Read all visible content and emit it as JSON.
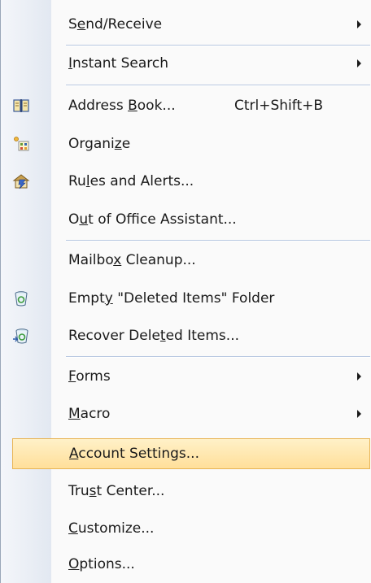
{
  "menu": {
    "items": [
      {
        "id": "send-receive",
        "pre": "S",
        "u": "e",
        "post": "nd/Receive",
        "submenu": true
      },
      {
        "id": "instant-search",
        "pre": "",
        "u": "I",
        "post": "nstant Search",
        "submenu": true
      },
      {
        "id": "address-book",
        "pre": "Address ",
        "u": "B",
        "post": "ook...",
        "shortcut": "Ctrl+Shift+B",
        "icon": "address-book-icon"
      },
      {
        "id": "organize",
        "pre": "Organi",
        "u": "z",
        "post": "e",
        "icon": "organize-icon"
      },
      {
        "id": "rules-and-alerts",
        "pre": "Ru",
        "u": "l",
        "post": "es and Alerts...",
        "icon": "rules-alerts-icon"
      },
      {
        "id": "out-of-office",
        "pre": "O",
        "u": "u",
        "post": "t of Office Assistant..."
      },
      {
        "id": "mailbox-cleanup",
        "pre": "Mailbo",
        "u": "x",
        "post": " Cleanup..."
      },
      {
        "id": "empty-deleted",
        "pre": "Empt",
        "u": "y",
        "post": " \"Deleted Items\" Folder",
        "icon": "recycle-bin-icon"
      },
      {
        "id": "recover-deleted",
        "pre": "Recover Dele",
        "u": "t",
        "post": "ed Items...",
        "icon": "recover-bin-icon"
      },
      {
        "id": "forms",
        "pre": "",
        "u": "F",
        "post": "orms",
        "submenu": true
      },
      {
        "id": "macro",
        "pre": "",
        "u": "M",
        "post": "acro",
        "submenu": true
      },
      {
        "id": "account-settings",
        "pre": "",
        "u": "A",
        "post": "ccount Settings...",
        "highlighted": true
      },
      {
        "id": "trust-center",
        "pre": "Tru",
        "u": "s",
        "post": "t Center..."
      },
      {
        "id": "customize",
        "pre": "",
        "u": "C",
        "post": "ustomize..."
      },
      {
        "id": "options",
        "pre": "",
        "u": "O",
        "post": "ptions..."
      }
    ]
  },
  "colors": {
    "highlight_top": "#fff1c8",
    "highlight_bottom": "#ffdf9a",
    "highlight_border": "#e8b455",
    "separator": "#b7c7e0"
  }
}
